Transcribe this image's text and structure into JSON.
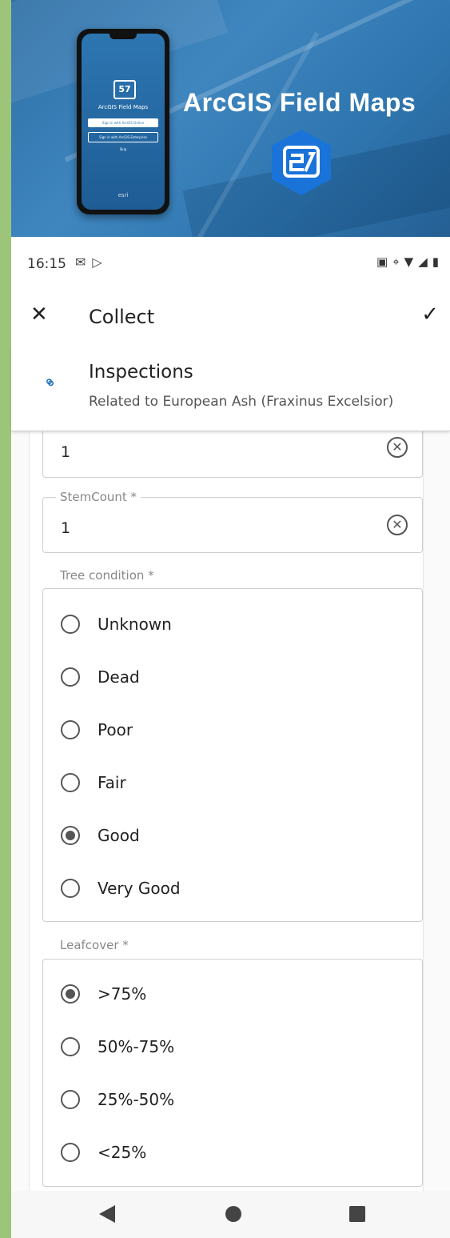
{
  "banner": {
    "title": "ArcGIS Field Maps",
    "phone_title": "ArcGIS Field Maps",
    "phone_button_online": "Sign in with ArcGIS Online",
    "phone_button_enterprise": "Sign in with ArcGIS Enterprise",
    "phone_skip": "Skip",
    "phone_brand": "esri"
  },
  "status_bar": {
    "time": "16:15",
    "left_icons": [
      "outlook-icon",
      "play-store-icon"
    ],
    "right_icons": [
      "nfc-icon",
      "location-icon",
      "wifi-icon",
      "4g-signal-icon",
      "battery-icon"
    ]
  },
  "app_bar": {
    "title": "Collect"
  },
  "related": {
    "layer_name": "Inspections",
    "subtitle": "Related to European Ash (Fraxinus Excelsior)"
  },
  "form": {
    "first_field_value": "1",
    "stem_count": {
      "label": "StemCount *",
      "value": "1"
    },
    "tree_condition": {
      "label": "Tree condition *",
      "options": [
        "Unknown",
        "Dead",
        "Poor",
        "Fair",
        "Good",
        "Very Good"
      ],
      "selected": "Good"
    },
    "leafcover": {
      "label": "Leafcover *",
      "options": [
        ">75%",
        "50%-75%",
        "25%-50%",
        "<25%"
      ],
      "selected": ">75%"
    }
  },
  "colors": {
    "accent_link": "#1e6fc0",
    "banner_blue": "#2f76b0",
    "side_green": "#9dc57a"
  }
}
